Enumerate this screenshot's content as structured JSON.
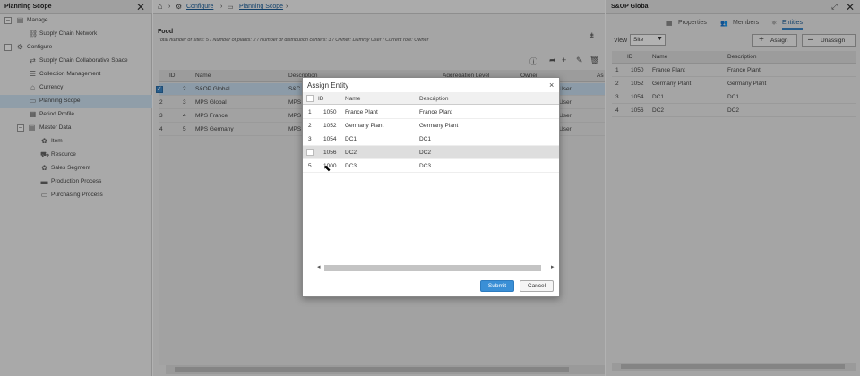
{
  "left_panel": {
    "title": "Planning Scope",
    "close_glyph": "✕",
    "items": [
      {
        "label": "Manage",
        "icon": "manage-icon",
        "toggle": "–"
      },
      {
        "label": "Supply Chain Network",
        "icon": "network-icon"
      },
      {
        "label": "Configure",
        "icon": "gear-icon",
        "toggle": "–"
      },
      {
        "label": "Supply Chain Collaborative Space",
        "icon": "collab-icon"
      },
      {
        "label": "Collection Management",
        "icon": "collection-icon"
      },
      {
        "label": "Currency",
        "icon": "currency-icon"
      },
      {
        "label": "Planning Scope",
        "icon": "scope-icon",
        "selected": true
      },
      {
        "label": "Period Profile",
        "icon": "period-icon"
      },
      {
        "label": "Master Data",
        "icon": "masterdata-icon",
        "toggle": "–"
      },
      {
        "label": "Item",
        "icon": "item-icon"
      },
      {
        "label": "Resource",
        "icon": "resource-icon"
      },
      {
        "label": "Sales Segment",
        "icon": "segment-icon"
      },
      {
        "label": "Production Process",
        "icon": "production-icon"
      },
      {
        "label": "Purchasing Process",
        "icon": "purchasing-icon"
      }
    ]
  },
  "breadcrumb": {
    "home_glyph": "⌂",
    "sep": "›",
    "configure": "Configure",
    "planning_scope": "Planning Scope"
  },
  "food": {
    "title": "Food",
    "subtitle": "Total number of sites: 5 / Number of plants: 2 / Number of distribution centers: 3 / Owner: Dummy User / Current role: Owner"
  },
  "grid": {
    "columns": {
      "id": "ID",
      "name": "Name",
      "description": "Description",
      "aggregation": "Aggregation Level",
      "owner": "Owner",
      "as": "As"
    },
    "rows": [
      {
        "num": "1",
        "id": "2",
        "name": "S&OP Global",
        "desc": "S&C",
        "owner": "User",
        "checked": true
      },
      {
        "num": "2",
        "id": "3",
        "name": "MPS Global",
        "desc": "MPS",
        "owner": "User"
      },
      {
        "num": "3",
        "id": "4",
        "name": "MPS France",
        "desc": "MPS",
        "owner": "User"
      },
      {
        "num": "4",
        "id": "5",
        "name": "MPS Germany",
        "desc": "MPS",
        "owner": "User"
      }
    ]
  },
  "right_panel": {
    "title": "S&OP Global",
    "tabs": {
      "properties": "Properties",
      "members": "Members",
      "entities": "Entities"
    },
    "view_label": "View",
    "view_value": "Site",
    "assign_label": "Assign",
    "unassign_label": "Unassign",
    "columns": {
      "id": "ID",
      "name": "Name",
      "description": "Description"
    },
    "rows": [
      {
        "num": "1",
        "id": "1050",
        "name": "France Plant",
        "desc": "France Plant"
      },
      {
        "num": "2",
        "id": "1052",
        "name": "Germany Plant",
        "desc": "Germany Plant"
      },
      {
        "num": "3",
        "id": "1054",
        "name": "DC1",
        "desc": "DC1"
      },
      {
        "num": "4",
        "id": "1056",
        "name": "DC2",
        "desc": "DC2"
      }
    ]
  },
  "modal": {
    "title": "Assign Entity",
    "close_glyph": "×",
    "columns": {
      "id": "ID",
      "name": "Name",
      "description": "Description"
    },
    "rows": [
      {
        "num": "1",
        "id": "1050",
        "name": "France Plant",
        "desc": "France Plant"
      },
      {
        "num": "2",
        "id": "1052",
        "name": "Germany Plant",
        "desc": "Germany Plant"
      },
      {
        "num": "3",
        "id": "1054",
        "name": "DC1",
        "desc": "DC1"
      },
      {
        "num": "4",
        "id": "1056",
        "name": "DC2",
        "desc": "DC2"
      },
      {
        "num": "5",
        "id": "1000",
        "name": "DC3",
        "desc": "DC3"
      }
    ],
    "submit_label": "Submit",
    "cancel_label": "Cancel"
  },
  "colors": {
    "accent": "#3a8fd6",
    "selected_row": "#c9dff1"
  }
}
